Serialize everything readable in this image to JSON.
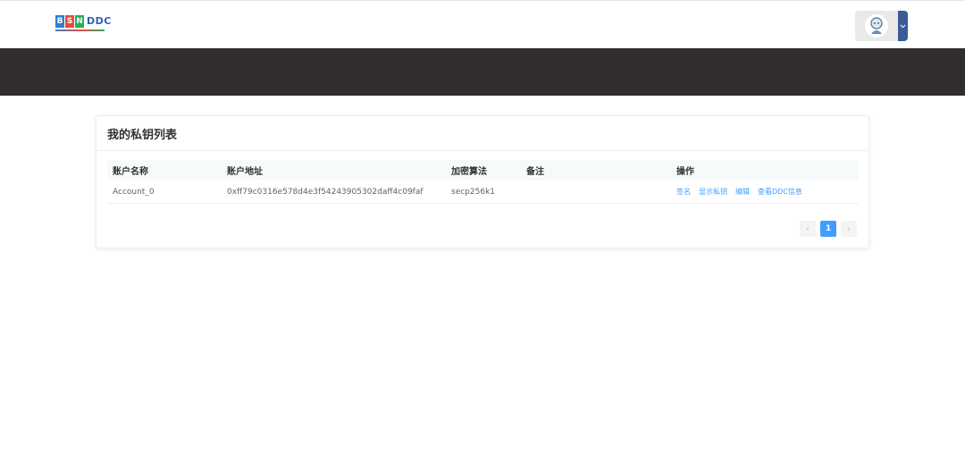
{
  "header": {
    "logo_letters": [
      "B",
      "S",
      "N"
    ],
    "logo_suffix": "DDC"
  },
  "card": {
    "title": "我的私钥列表"
  },
  "table": {
    "columns": [
      "账户名称",
      "账户地址",
      "加密算法",
      "备注",
      "操作"
    ],
    "rows": [
      {
        "name": "Account_0",
        "address": "0xff79c0316e578d4e3f54243905302daff4c09faf",
        "algorithm": "secp256k1",
        "remark": "",
        "actions": [
          "签名",
          "显示私钥",
          "编辑",
          "查看DDC信息"
        ]
      }
    ]
  },
  "pagination": {
    "prev": "‹",
    "current": "1",
    "next": "›"
  },
  "colors": {
    "accent": "#409eff",
    "banner": "#302d2c",
    "dropdown": "#3d5a98"
  }
}
